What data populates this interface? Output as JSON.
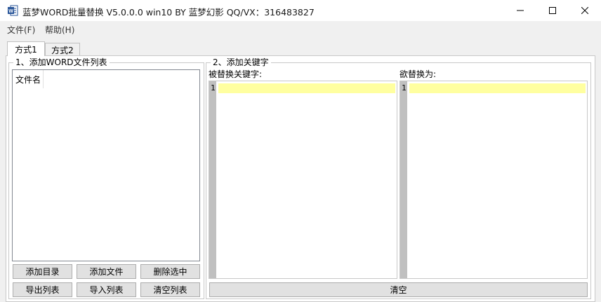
{
  "window": {
    "title": "蓝梦WORD批量替换 V5.0.0.0 win10 BY 蓝梦幻影 QQ/VX：316483827",
    "app_icon": "word-icon",
    "controls": [
      "minimize-icon",
      "maximize-icon",
      "close-icon"
    ]
  },
  "menu": {
    "file": "文件(F)",
    "help": "帮助(H)"
  },
  "tabs": [
    {
      "label": "方式1",
      "active": true
    },
    {
      "label": "方式2",
      "active": false
    }
  ],
  "group1": {
    "title": "1、添加WORD文件列表",
    "column_header": "文件名",
    "buttons": {
      "add_dir": "添加目录",
      "add_file": "添加文件",
      "delete_selected": "删除选中",
      "export_list": "导出列表",
      "import_list": "导入列表",
      "clear_list": "清空列表"
    }
  },
  "group2": {
    "title": "2、添加关键字",
    "find_label": "被替换关键字:",
    "replace_label": "欲替换为:",
    "find_line_number": "1",
    "replace_line_number": "1",
    "clear_button": "清空"
  },
  "colors": {
    "line_highlight": "#ffffa0",
    "gutter": "#c0c0c0",
    "word_icon": "#2b579a"
  }
}
